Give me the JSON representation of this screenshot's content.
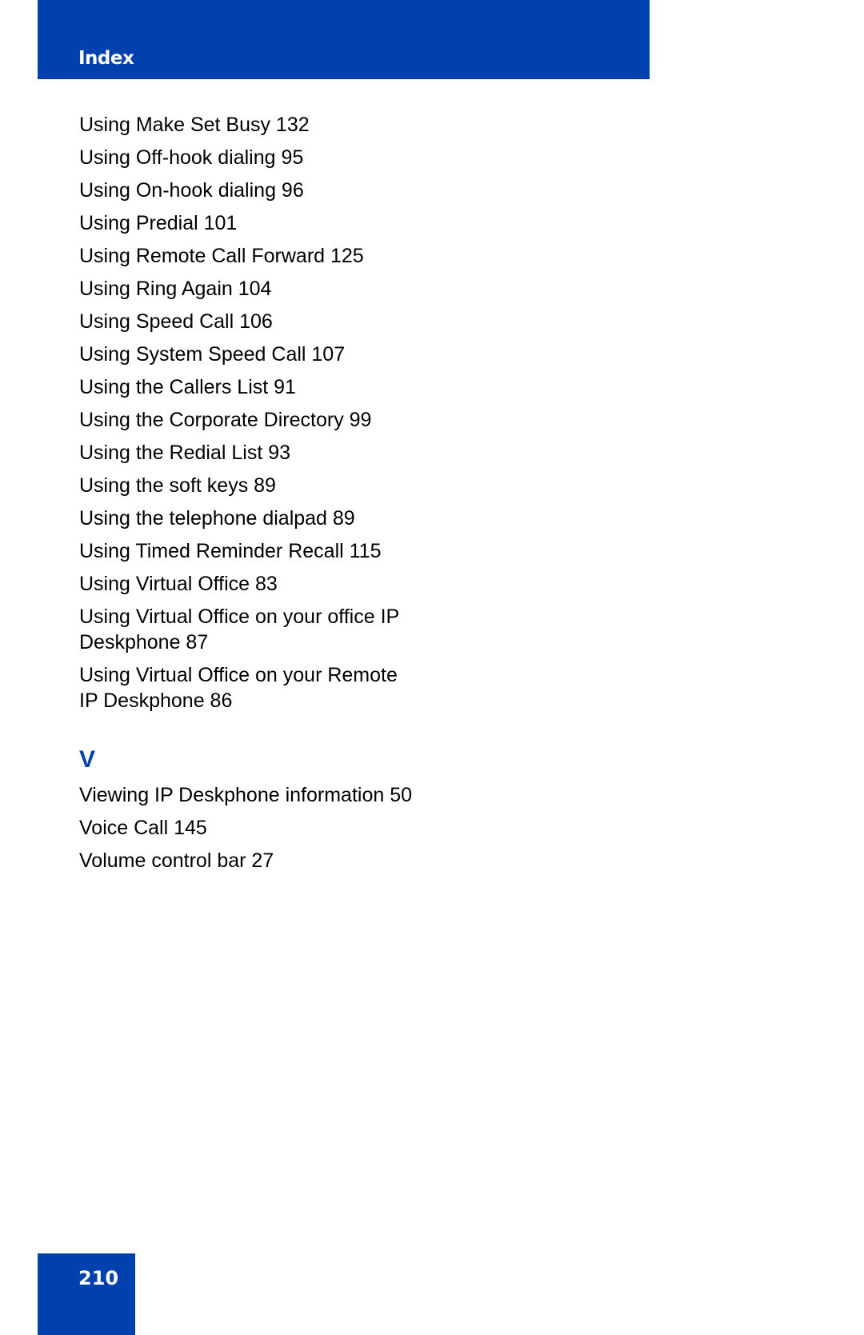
{
  "header": {
    "title": "Index"
  },
  "entries_u": [
    "Using Make Set Busy 132",
    "Using Off-hook dialing 95",
    "Using On-hook dialing 96",
    "Using Predial 101",
    "Using Remote Call Forward 125",
    "Using Ring Again 104",
    "Using Speed Call 106",
    "Using System Speed Call 107",
    "Using the Callers List 91",
    "Using the Corporate Directory 99",
    "Using the Redial List 93",
    "Using the soft keys 89",
    "Using the telephone dialpad 89",
    "Using Timed Reminder Recall 115",
    "Using Virtual Office 83",
    "Using Virtual Office on your office IP Deskphone 87",
    "Using Virtual Office on your Remote IP Deskphone 86"
  ],
  "section_v": {
    "letter": "V",
    "entries": [
      "Viewing IP Deskphone information 50",
      "Voice Call 145",
      "Volume control bar 27"
    ]
  },
  "footer": {
    "page_number": "210"
  },
  "colors": {
    "brand_blue": "#0041ad"
  }
}
